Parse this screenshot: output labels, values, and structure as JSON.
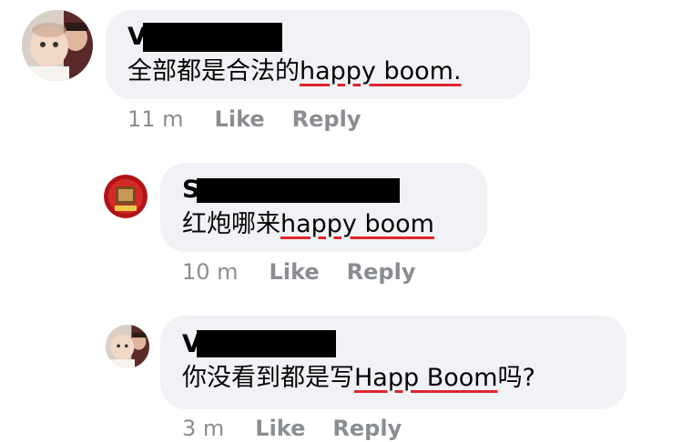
{
  "comments": [
    {
      "author": "V",
      "text_before": "全部都是合法的",
      "text_underlined": "happy boom.",
      "text_after": "",
      "time": "11 m",
      "like": "Like",
      "reply": "Reply",
      "avatar": "baby-photo-avatar"
    },
    {
      "author": "S",
      "text_before": "红炮哪来",
      "text_underlined": "happy boom",
      "text_after": "",
      "time": "10 m",
      "like": "Like",
      "reply": "Reply",
      "avatar": "red-emblem-avatar"
    },
    {
      "author": "V",
      "text_before": "你没看到都是写",
      "text_underlined": "Happ Boom",
      "text_after": "吗?",
      "time": "3 m",
      "like": "Like",
      "reply": "Reply",
      "avatar": "baby-photo-avatar"
    }
  ],
  "colors": {
    "bubble": "#f0f2f5",
    "meta": "#8a8d91",
    "underline": "#e0242b",
    "redaction": "#000000"
  }
}
